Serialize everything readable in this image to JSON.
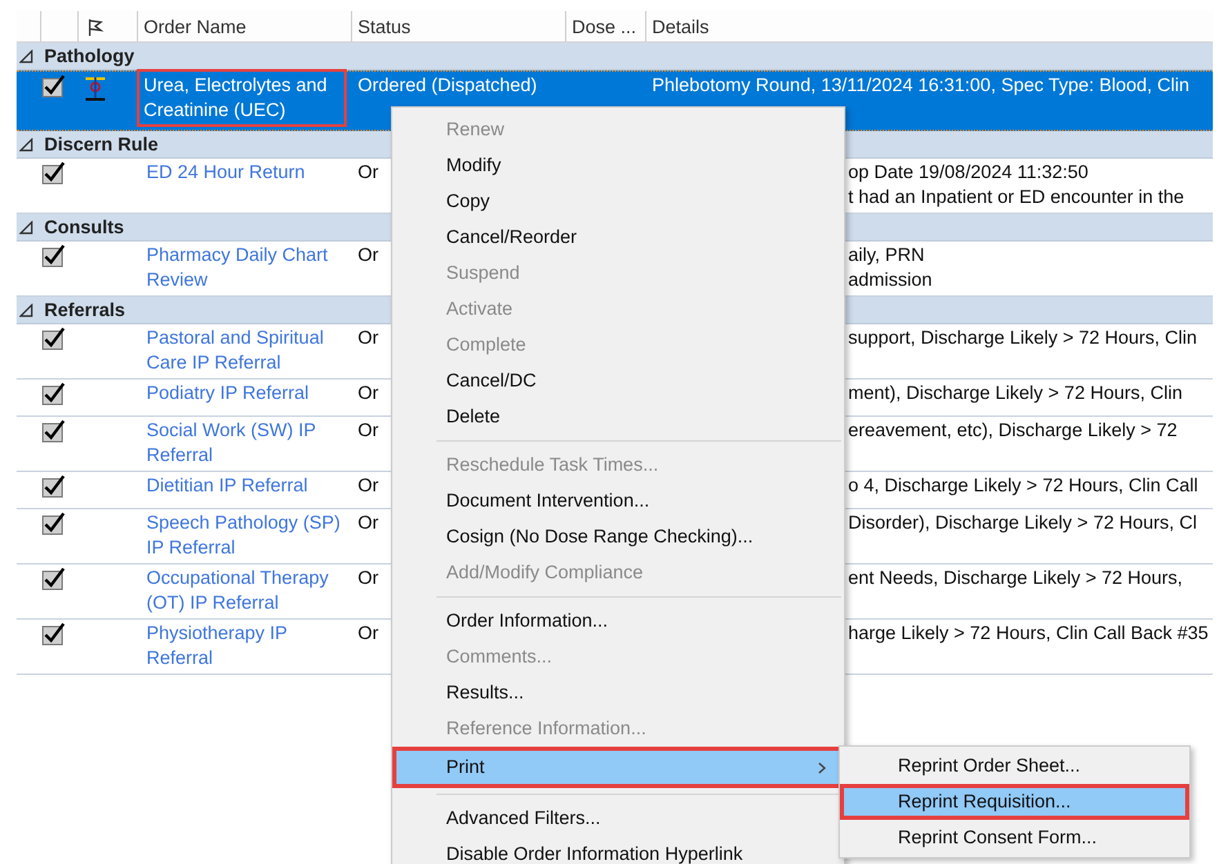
{
  "table": {
    "columns": [
      "Order Name",
      "Status",
      "Dose ...",
      "Details"
    ],
    "groups": [
      {
        "name": "Pathology",
        "expanded": true,
        "rows": [
          {
            "checked": true,
            "has_icon": true,
            "selected": true,
            "highlighted": true,
            "name": "Urea, Electrolytes and Creatinine (UEC)",
            "status": "Ordered (Dispatched)",
            "details": [
              "Phlebotomy Round, 13/11/2024 16:31:00, Spec Type: Blood, Clin"
            ]
          }
        ]
      },
      {
        "name": "Discern Rule",
        "expanded": true,
        "rows": [
          {
            "checked": true,
            "has_icon": false,
            "selected": false,
            "highlighted": false,
            "name": "ED 24 Hour Return",
            "status": "Or",
            "details": [
              "op Date 19/08/2024 11:32:50",
              "t had an Inpatient or ED encounter in the"
            ]
          }
        ]
      },
      {
        "name": "Consults",
        "expanded": true,
        "rows": [
          {
            "checked": true,
            "has_icon": false,
            "selected": false,
            "highlighted": false,
            "name": "Pharmacy Daily Chart Review",
            "status": "Or",
            "details": [
              "aily, PRN",
              "admission"
            ]
          }
        ]
      },
      {
        "name": "Referrals",
        "expanded": true,
        "rows": [
          {
            "checked": true,
            "has_icon": false,
            "selected": false,
            "highlighted": false,
            "name": "Pastoral and Spiritual Care IP Referral",
            "status": "Or",
            "details": [
              "support, Discharge Likely > 72 Hours, Clin"
            ]
          },
          {
            "checked": true,
            "has_icon": false,
            "selected": false,
            "highlighted": false,
            "name": "Podiatry IP Referral",
            "status": "Or",
            "details": [
              "ment), Discharge Likely > 72 Hours, Clin"
            ]
          },
          {
            "checked": true,
            "has_icon": false,
            "selected": false,
            "highlighted": false,
            "name": "Social Work (SW) IP Referral",
            "status": "Or",
            "details": [
              "ereavement, etc), Discharge Likely > 72"
            ]
          },
          {
            "checked": true,
            "has_icon": false,
            "selected": false,
            "highlighted": false,
            "name": "Dietitian IP Referral",
            "status": "Or",
            "details": [
              "o 4, Discharge Likely > 72 Hours, Clin Call"
            ]
          },
          {
            "checked": true,
            "has_icon": false,
            "selected": false,
            "highlighted": false,
            "name": "Speech Pathology (SP) IP Referral",
            "status": "Or",
            "details": [
              "Disorder), Discharge Likely > 72 Hours, Cl"
            ]
          },
          {
            "checked": true,
            "has_icon": false,
            "selected": false,
            "highlighted": false,
            "name": "Occupational Therapy (OT) IP Referral",
            "status": "Or",
            "details": [
              "ent Needs, Discharge Likely > 72 Hours,"
            ]
          },
          {
            "checked": true,
            "has_icon": false,
            "selected": false,
            "highlighted": false,
            "name": "Physiotherapy IP Referral",
            "status": "Or",
            "details": [
              "harge Likely > 72 Hours, Clin Call Back #35"
            ]
          }
        ]
      }
    ]
  },
  "context_menu": {
    "items": [
      {
        "kind": "item",
        "label": "Renew",
        "disabled": true
      },
      {
        "kind": "item",
        "label": "Modify",
        "disabled": false
      },
      {
        "kind": "item",
        "label": "Copy",
        "disabled": false
      },
      {
        "kind": "item",
        "label": "Cancel/Reorder",
        "disabled": false
      },
      {
        "kind": "item",
        "label": "Suspend",
        "disabled": true
      },
      {
        "kind": "item",
        "label": "Activate",
        "disabled": true
      },
      {
        "kind": "item",
        "label": "Complete",
        "disabled": true
      },
      {
        "kind": "item",
        "label": "Cancel/DC",
        "disabled": false
      },
      {
        "kind": "item",
        "label": "Delete",
        "disabled": false
      },
      {
        "kind": "separator"
      },
      {
        "kind": "item",
        "label": "Reschedule Task Times...",
        "disabled": true
      },
      {
        "kind": "item",
        "label": "Document Intervention...",
        "disabled": false
      },
      {
        "kind": "item",
        "label": "Cosign (No Dose Range Checking)...",
        "disabled": false
      },
      {
        "kind": "item",
        "label": "Add/Modify Compliance",
        "disabled": true
      },
      {
        "kind": "separator"
      },
      {
        "kind": "item",
        "label": "Order Information...",
        "disabled": false
      },
      {
        "kind": "item",
        "label": "Comments...",
        "disabled": true
      },
      {
        "kind": "item",
        "label": "Results...",
        "disabled": false
      },
      {
        "kind": "item",
        "label": "Reference Information...",
        "disabled": true
      },
      {
        "kind": "submenu",
        "label": "Print",
        "disabled": false,
        "selected": true,
        "highlighted": true
      },
      {
        "kind": "separator"
      },
      {
        "kind": "item",
        "label": "Advanced Filters...",
        "disabled": false
      },
      {
        "kind": "item",
        "label": "Disable Order Information Hyperlink",
        "disabled": false
      }
    ]
  },
  "submenu": {
    "items": [
      {
        "label": "Reprint Order Sheet...",
        "selected": false,
        "highlighted": false
      },
      {
        "label": "Reprint Requisition...",
        "selected": true,
        "highlighted": true
      },
      {
        "label": "Reprint Consent Form...",
        "selected": false,
        "highlighted": false
      }
    ]
  }
}
